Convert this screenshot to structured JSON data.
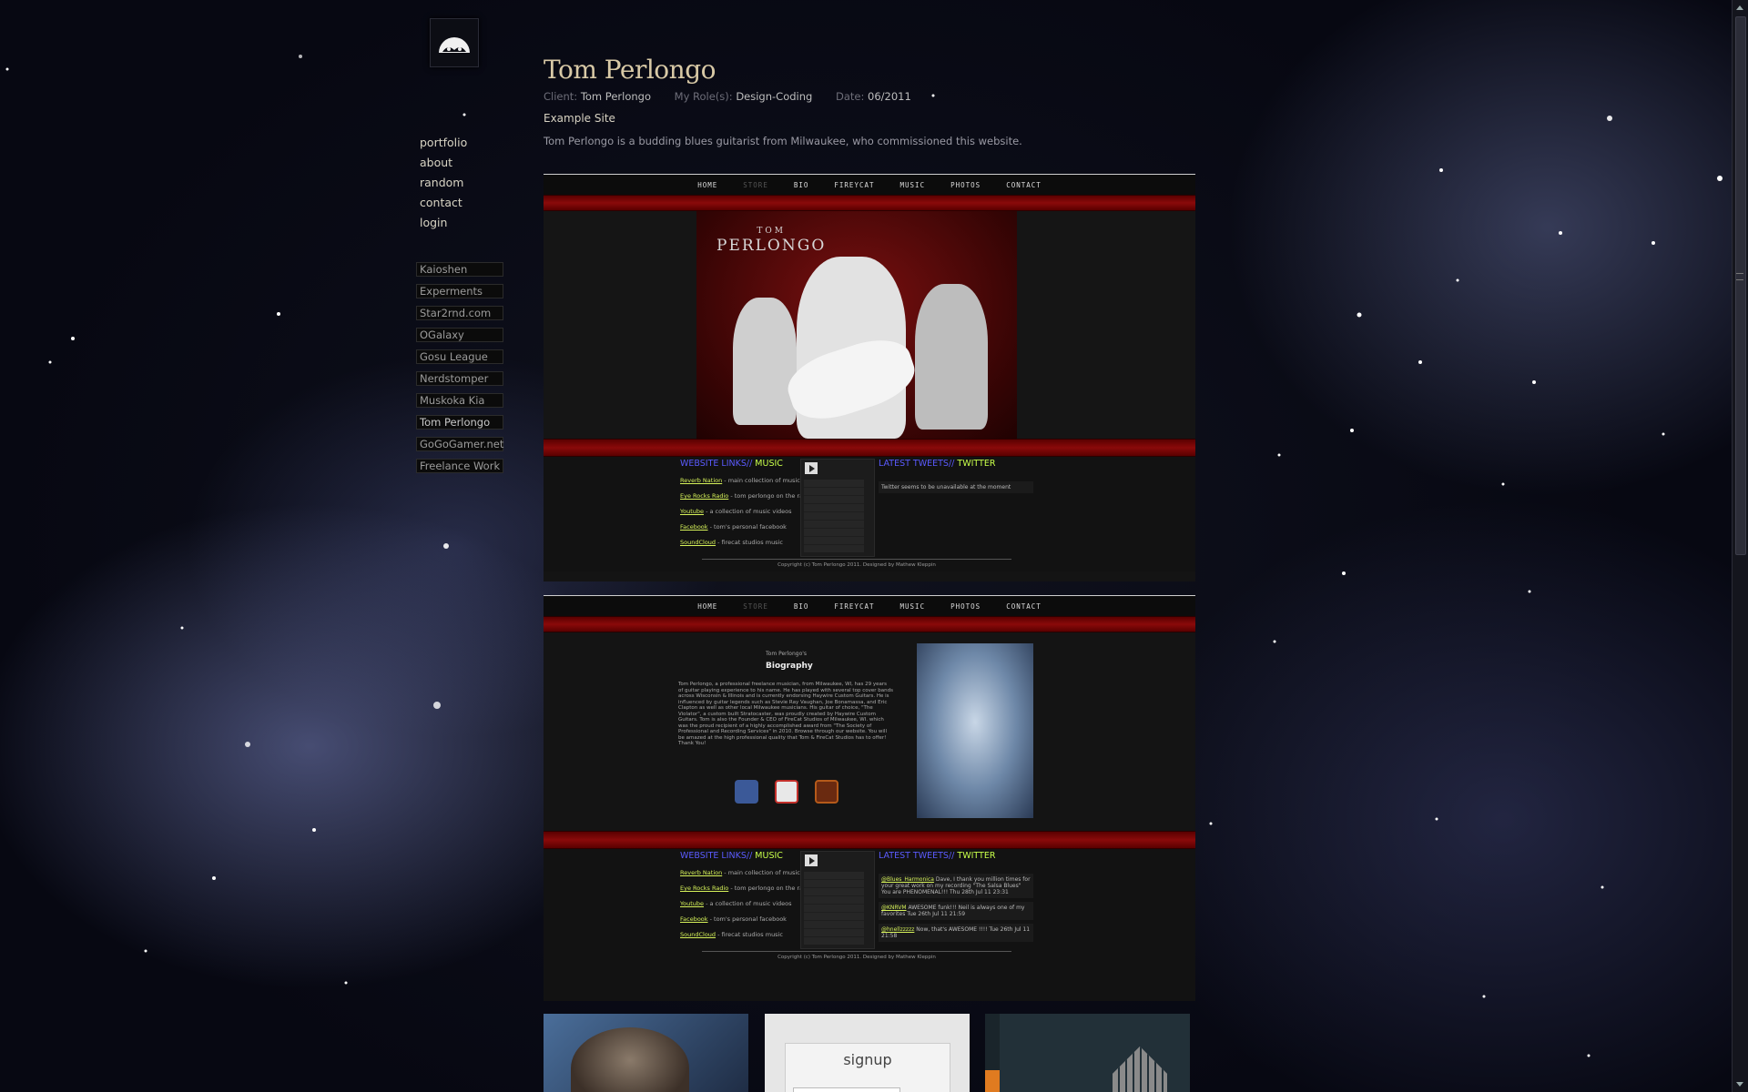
{
  "nav": [
    "portfolio",
    "about",
    "random",
    "contact",
    "login"
  ],
  "projects": [
    "Kaioshen",
    "Experments",
    "Star2rnd.com",
    "OGalaxy",
    "Gosu League",
    "Nerdstomper",
    "Muskoka Kia",
    "Tom Perlongo",
    "GoGoGamer.net",
    "Freelance Work"
  ],
  "active_project": "Tom Perlongo",
  "project": {
    "title": "Tom Perlongo",
    "client_label": "Client:",
    "client": "Tom Perlongo",
    "role_label": "My Role(s):",
    "role": "Design-Coding",
    "date_label": "Date:",
    "date": "06/2011",
    "link": "Example Site",
    "description": "Tom Perlongo is a budding blues guitarist from Milwaukee, who commissioned this website."
  },
  "mockup": {
    "nav": [
      "HOME",
      "STORE",
      "BIO",
      "FIREYCAT",
      "MUSIC",
      "PHOTOS",
      "CONTACT"
    ],
    "brand_small": "TOM",
    "brand": "PERLONGO",
    "links_heading_a": "WEBSITE LINKS//",
    "links_heading_b": "MUSIC",
    "links": [
      {
        "name": "Reverb Nation",
        "desc": " - main collection of music"
      },
      {
        "name": "Eye Rocks Radio",
        "desc": " - tom perlongo on the radio"
      },
      {
        "name": "Youtube",
        "desc": " - a collection of music videos"
      },
      {
        "name": "Facebook",
        "desc": " - tom's personal facebook"
      },
      {
        "name": "SoundCloud",
        "desc": " - firecat studios music"
      }
    ],
    "tweets_heading_a": "LATEST TWEETS//",
    "tweets_heading_b": "TWITTER",
    "tweets_unavailable": "Twitter seems to be unavailable at the moment",
    "tweets": [
      {
        "user": "@Blues_Harmonica",
        "text": " Dave, I thank you million times for your great work on my recording \"The Salsa Blues\" You are PHENOMENAL!!! Thu 28th Jul 11 23:31"
      },
      {
        "user": "@KNRVM",
        "text": " AWESOME funk!!! Neil is always one of my favorites Tue 26th Jul 11 21:59"
      },
      {
        "user": "@hnellzzzzz",
        "text": " Now, that's AWESOME !!!! Tue 26th Jul 11 21:58"
      }
    ],
    "copyright": "Copyright (c) Tom Perlongo 2011. Designed by Mathew Kleppin",
    "bio_small": "Tom Perlongo's",
    "bio_heading": "Biography",
    "bio_text": "Tom Perlongo, a professional freelance musician, from Milwaukee, WI, has 29 years of guitar playing experience to his name. He has played with several top cover bands across Wisconsin & Illinois and is currently endorsing Haywire Custom Guitars. He is influenced by guitar legends such as Stevie Ray Vaughan, Joe Bonamassa, and Eric Clapton as well as other local Milwaukee musicians. His guitar of choice, \"The Violator\", a custom built Stratocaster, was proudly created by Haywire Custom Guitars. Tom is also the Founder & CEO of FireCat Studios of Milwaukee, WI. which was the proud recipient of a highly accomplished award from \"The Society of Professional and Recording Services\" in 2010. Browse through our website. You will be amazed at the high professional quality that Tom & FireCat Studios has to offer! Thank You!"
  },
  "thumb_signup": "signup",
  "colors": {
    "accent_red": "#8a0a0a",
    "link_blue": "#5b5bff",
    "link_green": "#c8ff4a"
  }
}
